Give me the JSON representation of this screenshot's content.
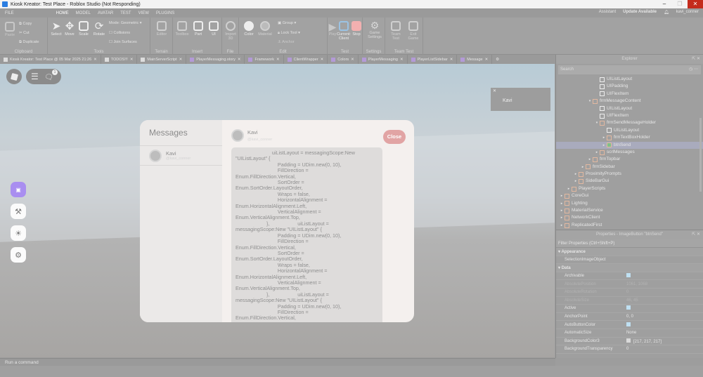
{
  "window": {
    "title": "Kiosk Kreator: Test Place - Roblox Studio (Not Responding)"
  },
  "menu": {
    "file": "FILE",
    "tabs": [
      "HOME",
      "MODEL",
      "AVATAR",
      "TEST",
      "VIEW",
      "PLUGINS"
    ],
    "assistant": "Assistant",
    "update": "Update Available",
    "user": "kavi_conner"
  },
  "ribbon": {
    "clipboard": {
      "paste": "Paste",
      "copy": "Copy",
      "cut": "Cut",
      "duplicate": "Duplicate",
      "label": "Clipboard"
    },
    "tools": {
      "select": "Select",
      "move": "Move",
      "scale": "Scale",
      "rotate": "Rotate",
      "mode_label": "Mode:",
      "mode_value": "Geometric",
      "collisions": "Collisions",
      "join_surfaces": "Join Surfaces",
      "label": "Tools"
    },
    "terrain": {
      "editor": "Editor",
      "label": "Terrain"
    },
    "insert": {
      "toolbox": "Toolbox",
      "part": "Part",
      "ui": "UI",
      "label": "Insert"
    },
    "file": {
      "import3d": "Import 3D",
      "label": "File"
    },
    "edit": {
      "color": "Color",
      "material": "Material",
      "group": "Group",
      "lock_tool": "Lock Tool",
      "anchor": "Anchor",
      "label": "Edit"
    },
    "test": {
      "play": "Play",
      "current_client": "Current: Client",
      "stop": "Stop",
      "label": "Test"
    },
    "settings": {
      "game_settings": "Game Settings",
      "label": "Settings"
    },
    "team_test": {
      "team_test": "Team Test",
      "exit_game": "Exit Game",
      "label": "Team Test"
    }
  },
  "doc_tabs": [
    "Kiosk Kreator: Test Place @ 05 Mar 2025 21:26",
    "TODOS!!!",
    "MainServerScript",
    "PlayerMessaging.story",
    "Framework",
    "ClientWrapper",
    "Colors",
    "PlayerMessaging",
    "PlayerListSidebar",
    "Message"
  ],
  "viewport": {
    "chat_badge": "1",
    "notification": {
      "name": "Kavi"
    },
    "messages": {
      "title": "Messages",
      "contact": {
        "name": "Kavi",
        "handle": "@kavi_conner"
      },
      "header": {
        "name": "Kavi",
        "handle": "@kavi_conner"
      },
      "close": "Close",
      "code": "                          uiListLayout = messagingScope:New \"UIListLayout\" {\n                              Padding = UDim.new(0, 10),\n                              FillDirection =\nEnum.FillDirection.Vertical,\n                              SortOrder =\nEnum.SortOrder.LayoutOrder,\n                              Wraps = false,\n                              HorizontalAlignment =\nEnum.HorizontalAlignment.Left,\n                              VerticalAlignment =\nEnum.VerticalAlignment.Top,\n                      },                    uiListLayout =\nmessagingScope:New \"UIListLayout\" {\n                              Padding = UDim.new(0, 10),\n                              FillDirection =\nEnum.FillDirection.Vertical,\n                              SortOrder =\nEnum.SortOrder.LayoutOrder,\n                              Wraps = false,\n                              HorizontalAlignment =\nEnum.HorizontalAlignment.Left,\n                              VerticalAlignment =\nEnum.VerticalAlignment.Top,\n                      },                    uiListLayout =\nmessagingScope:New \"UIListLayout\" {\n                              Padding = UDim.new(0, 10),\n                              FillDirection =\nEnum.FillDirection.Vertical,"
    }
  },
  "explorer": {
    "title": "Explorer",
    "search_placeholder": "Search",
    "items": [
      {
        "label": "UIListLayout",
        "depth": 5
      },
      {
        "label": "UIPadding",
        "depth": 5
      },
      {
        "label": "UIFlexItem",
        "depth": 5
      },
      {
        "label": "frmMessageContent",
        "depth": 4
      },
      {
        "label": "UIListLayout",
        "depth": 5
      },
      {
        "label": "UIFlexItem",
        "depth": 5
      },
      {
        "label": "frmSendMessageHolder",
        "depth": 5
      },
      {
        "label": "UIListLayout",
        "depth": 6
      },
      {
        "label": "frmTextBoxHolder",
        "depth": 6
      },
      {
        "label": "btnSend",
        "depth": 6
      },
      {
        "label": "scrlMessages",
        "depth": 5
      },
      {
        "label": "frmTopbar",
        "depth": 4
      },
      {
        "label": "frmSidebar",
        "depth": 3
      },
      {
        "label": "ProximityPrompts",
        "depth": 2
      },
      {
        "label": "SideBarGui",
        "depth": 2
      },
      {
        "label": "PlayerScripts",
        "depth": 1
      },
      {
        "label": "CoreGui",
        "depth": 0
      },
      {
        "label": "Lighting",
        "depth": 0
      },
      {
        "label": "MaterialService",
        "depth": 0
      },
      {
        "label": "NetworkClient",
        "depth": 0
      },
      {
        "label": "ReplicatedFirst",
        "depth": 0
      }
    ]
  },
  "properties": {
    "title": "Properties - ImageButton \"btnSend\"",
    "filter_placeholder": "Filter Properties (Ctrl+Shift+P)",
    "rows": [
      {
        "name": "Appearance",
        "value": "",
        "type": "cat"
      },
      {
        "name": "SelectionImageObject",
        "value": "",
        "type": "prop"
      },
      {
        "name": "Data",
        "value": "",
        "type": "cat"
      },
      {
        "name": "Archivable",
        "value": "",
        "type": "check"
      },
      {
        "name": "AbsolutePosition",
        "value": "1061, 1068",
        "type": "dim"
      },
      {
        "name": "AbsoluteRotation",
        "value": "0",
        "type": "dim"
      },
      {
        "name": "AbsoluteSize",
        "value": "46, 45",
        "type": "dim"
      },
      {
        "name": "Active",
        "value": "",
        "type": "check"
      },
      {
        "name": "AnchorPoint",
        "value": "0, 0",
        "type": "prop"
      },
      {
        "name": "AutoButtonColor",
        "value": "",
        "type": "check"
      },
      {
        "name": "AutomaticSize",
        "value": "None",
        "type": "prop"
      },
      {
        "name": "BackgroundColor3",
        "value": "[217, 217, 217]",
        "type": "color"
      },
      {
        "name": "BackgroundTransparency",
        "value": "0",
        "type": "prop"
      }
    ]
  },
  "command_bar": {
    "placeholder": "Run a command"
  }
}
